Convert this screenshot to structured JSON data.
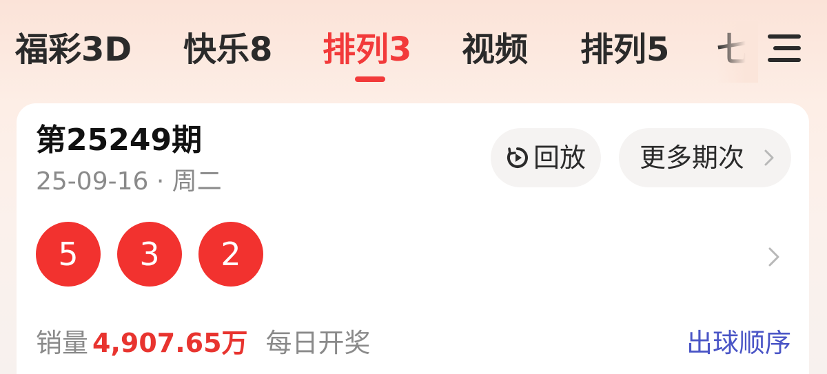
{
  "tabs": [
    {
      "label": "福彩3D",
      "active": false
    },
    {
      "label": "快乐8",
      "active": false
    },
    {
      "label": "排列3",
      "active": true
    },
    {
      "label": "视频",
      "active": false
    },
    {
      "label": "排列5",
      "active": false
    },
    {
      "label": "七",
      "active": false
    }
  ],
  "menu": {
    "icon": "menu-icon"
  },
  "draw": {
    "title": "第25249期",
    "date": "25-09-16 · 周二",
    "numbers": [
      "5",
      "3",
      "2"
    ],
    "ball_color": "#f2322f"
  },
  "actions": {
    "replay_label": "回放",
    "replay_icon": "replay-icon",
    "more_label": "更多期次",
    "more_icon": "chevron-right-icon"
  },
  "sales": {
    "label": "销量",
    "value": "4,907.65万",
    "frequency": "每日开奖"
  },
  "order_link": "出球顺序",
  "colors": {
    "accent": "#f23a3a",
    "link": "#4a55c6",
    "muted": "#8a8a8a"
  }
}
